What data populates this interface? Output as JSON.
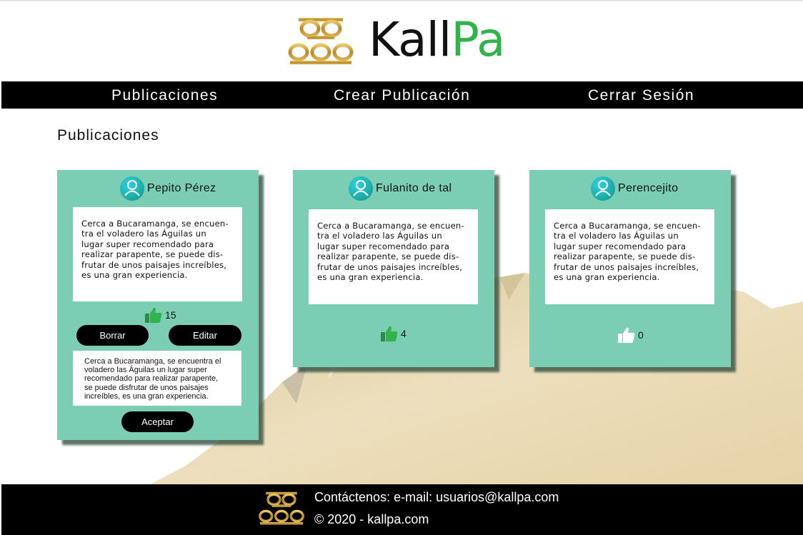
{
  "brand": {
    "name_part1": "Kall",
    "name_part2": "Pa",
    "gold": "#c9a13a",
    "green": "#2fb34a"
  },
  "nav": {
    "items": [
      {
        "label": "Publicaciones"
      },
      {
        "label": "Crear Publicación"
      },
      {
        "label": "Cerrar Sesión"
      }
    ]
  },
  "main": {
    "title": "Publicaciones",
    "card_color": "#7bcdb3"
  },
  "posts": [
    {
      "author": "Pepito Pérez",
      "text": "Cerca a Bucaramanga, se encuen-\ntra el voladero  las Águilas un\nlugar  super recomendado para\nrealizar parapente, se puede dis-\nfrutar de unos paisajes increíbles,\nes una gran experiencia.",
      "likes": "15",
      "delete_label": "Borrar",
      "edit_label": "Editar",
      "edit_text": "Cerca a Bucaramanga, se encuentra el\nvoladero  las Águilas un lugar  super\nrecomendado para  realizar parapente,\nse puede disfrutar de unos paisajes\nincreíbles, es una gran experiencia.",
      "accept_label": "Aceptar"
    },
    {
      "author": "Fulanito de tal",
      "text": "Cerca a Bucaramanga, se encuen-\ntra el voladero  las Águilas un\nlugar  super recomendado para\nrealizar parapente, se puede dis-\nfrutar de unos paisajes increíbles,\nes una gran experiencia.",
      "likes": "4"
    },
    {
      "author": "Perencejito",
      "text": "Cerca a Bucaramanga, se encuen-\ntra el voladero  las Águilas un\nlugar  super recomendado para\nrealizar parapente, se puede dis-\nfrutar de unos paisajes increíbles,\nes una gran experiencia.",
      "likes": "0"
    }
  ],
  "icons": {
    "like": "thumbs-up-icon",
    "user": "user-avatar-icon",
    "logo": "kallpa-logo-icon"
  },
  "footer": {
    "contact": "Contáctenos: e-mail: usuarios@kallpa.com",
    "copyright": "© 2020 - kallpa.com"
  }
}
